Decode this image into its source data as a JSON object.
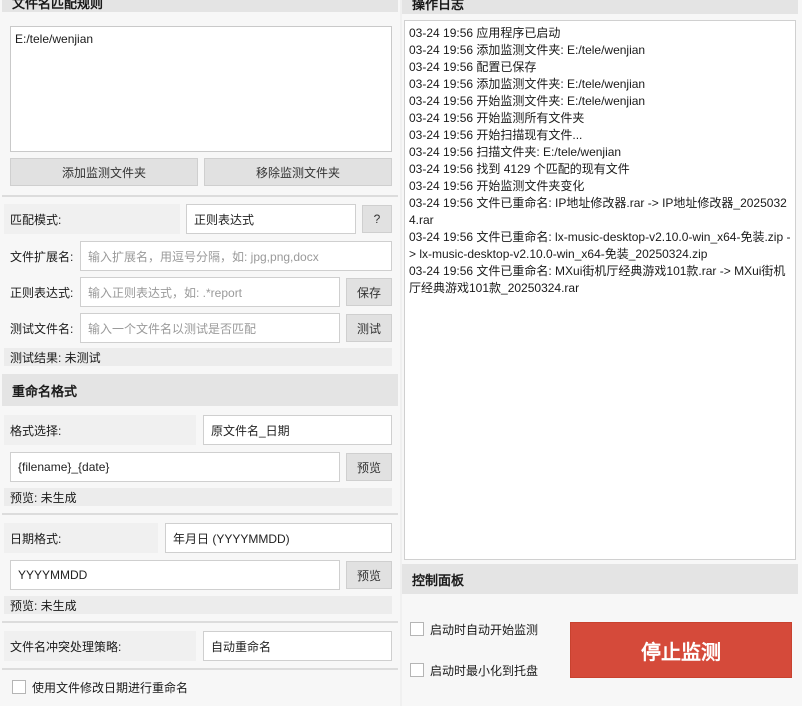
{
  "left": {
    "rules_title": "文件名匹配规则",
    "watch_paths": [
      "E:/tele/wenjian"
    ],
    "add_folder_button": "添加监测文件夹",
    "remove_folder_button": "移除监测文件夹",
    "match_mode_label": "匹配模式:",
    "match_mode_value": "正则表达式",
    "help_button": "?",
    "extension_label": "文件扩展名:",
    "extension_placeholder": "输入扩展名，用逗号分隔，如: jpg,png,docx",
    "regex_label": "正则表达式:",
    "regex_placeholder": "输入正则表达式，如: .*report",
    "save_button": "保存",
    "test_name_label": "测试文件名:",
    "test_name_placeholder": "输入一个文件名以测试是否匹配",
    "test_button": "测试",
    "test_result": "测试结果: 未测试",
    "rename_title": "重命名格式",
    "format_select_label": "格式选择:",
    "format_select_value": "原文件名_日期",
    "format_template": "{filename}_{date}",
    "preview_button_1": "预览",
    "preview_result_1": "预览: 未生成",
    "date_format_label": "日期格式:",
    "date_format_value": "年月日 (YYYYMMDD)",
    "date_template": "YYYYMMDD",
    "preview_button_2": "预览",
    "preview_result_2": "预览: 未生成",
    "conflict_label": "文件名冲突处理策略:",
    "conflict_value": "自动重命名",
    "use_mtime_label": "使用文件修改日期进行重命名"
  },
  "right": {
    "log_title": "操作日志",
    "log_lines": [
      "03-24 19:56 应用程序已启动",
      "03-24 19:56 添加监测文件夹: E:/tele/wenjian",
      "03-24 19:56 配置已保存",
      "03-24 19:56 添加监测文件夹: E:/tele/wenjian",
      "03-24 19:56 开始监测文件夹: E:/tele/wenjian",
      "03-24 19:56 开始监测所有文件夹",
      "03-24 19:56 开始扫描现有文件...",
      "03-24 19:56 扫描文件夹: E:/tele/wenjian",
      "03-24 19:56 找到 4129 个匹配的现有文件",
      "03-24 19:56 开始监测文件夹变化",
      "03-24 19:56 文件已重命名: IP地址修改器.rar -> IP地址修改器_20250324.rar",
      "03-24 19:56 文件已重命名: lx-music-desktop-v2.10.0-win_x64-免装.zip -> lx-music-desktop-v2.10.0-win_x64-免装_20250324.zip",
      "03-24 19:56 文件已重命名: MXui街机厅经典游戏101款.rar -> MXui街机厅经典游戏101款_20250324.rar"
    ],
    "control_title": "控制面板",
    "auto_start_label": "启动时自动开始监测",
    "minimize_tray_label": "启动时最小化到托盘",
    "stop_button": "停止监测",
    "accent_color": "#d54a3a"
  }
}
